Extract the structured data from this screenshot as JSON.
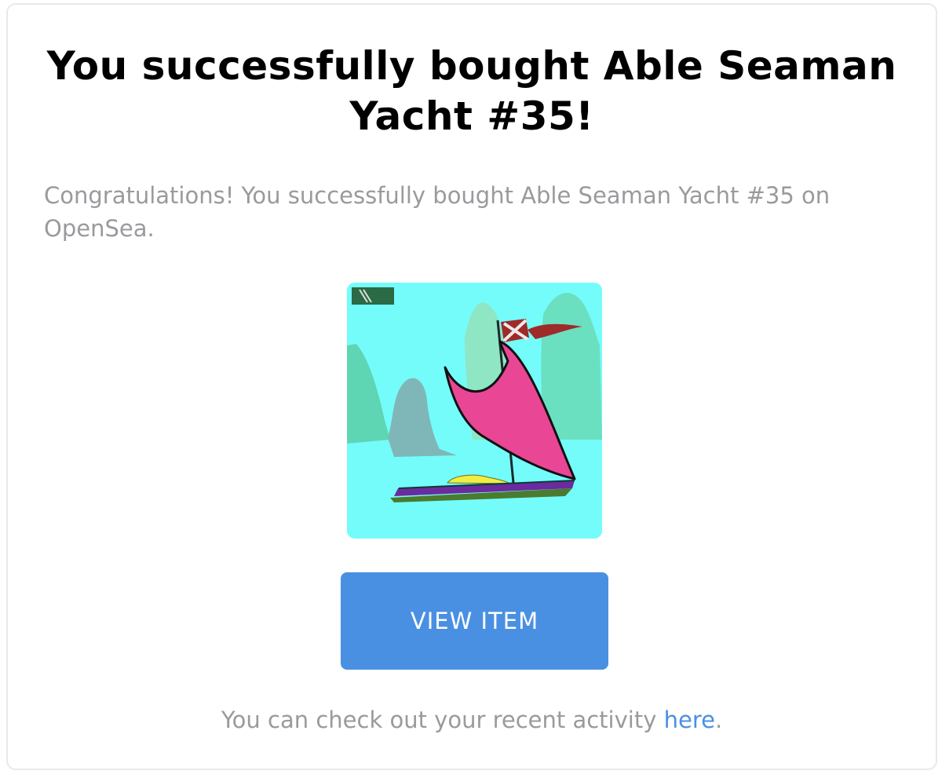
{
  "dialog": {
    "title": "You successfully bought Able Seaman Yacht #35!",
    "message": "Congratulations! You successfully bought Able Seaman Yacht #35 on OpenSea.",
    "item_image_icon": "sailboat-nft-image",
    "view_button_label": "VIEW ITEM",
    "footer_prefix": "You can check out your recent activity ",
    "footer_link": "here",
    "footer_suffix": "."
  },
  "colors": {
    "button": "#4a90e2",
    "link": "#4a90e2",
    "muted_text": "#9a9a9e",
    "title_text": "#000000"
  }
}
